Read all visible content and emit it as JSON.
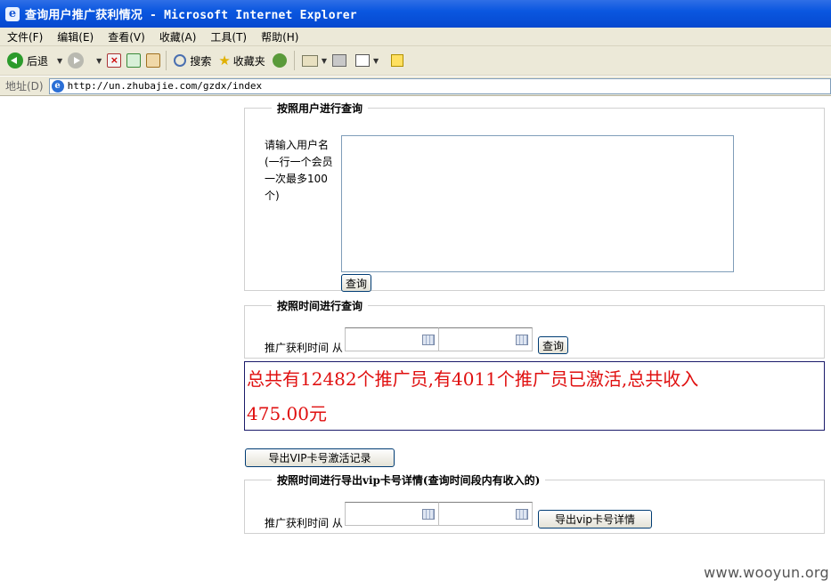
{
  "window": {
    "title": "查询用户推广获利情况 - Microsoft Internet Explorer"
  },
  "menubar": {
    "items": [
      "文件(F)",
      "编辑(E)",
      "查看(V)",
      "收藏(A)",
      "工具(T)",
      "帮助(H)"
    ]
  },
  "toolbar": {
    "back_label": "后退",
    "search_label": "搜索",
    "favorites_label": "收藏夹"
  },
  "addressbar": {
    "label": "地址(D)",
    "url": "http://un.zhubajie.com/gzdx/index"
  },
  "query_by_user": {
    "legend": "按照用户进行查询",
    "label_line1": "请输入用户名",
    "label_line2": "(一行一个会员",
    "label_line3": "一次最多100",
    "label_line4": "个)",
    "textarea_value": "",
    "query_button": "查询"
  },
  "query_by_time": {
    "legend": "按照时间进行查询",
    "label": "推广获利时间  从",
    "date_from": "",
    "date_to": "",
    "query_button": "查询"
  },
  "summary": {
    "line1": "总共有12482个推广员,有4011个推广员已激活,总共收入",
    "line2": "475.00元"
  },
  "export_vip_button": "导出VIP卡号激活记录",
  "export_by_time": {
    "legend": "按照时间进行导出vip卡号详情(查询时间段内有收入的)",
    "label": "推广获利时间  从",
    "date_from": "",
    "date_to": "",
    "export_button": "导出vip卡号详情"
  },
  "watermark": "www.wooyun.org",
  "colors": {
    "titlebar": "#0a57e0",
    "summary_text": "#e01010",
    "summary_border": "#1a1a6a"
  }
}
